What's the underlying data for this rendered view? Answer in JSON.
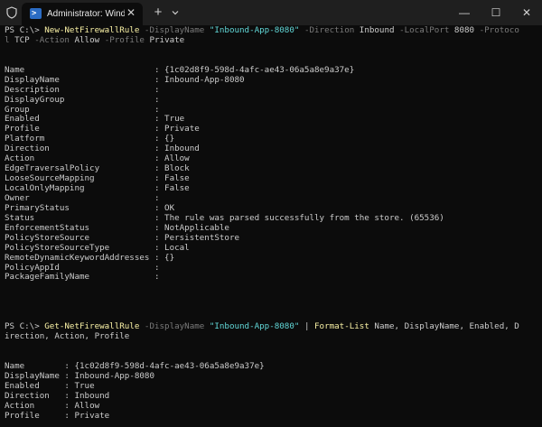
{
  "window": {
    "tab_title": "Administrator: Windows PowerShell",
    "tab_icon_glyph": ">",
    "close_glyph": "✕",
    "new_tab_glyph": "+",
    "minimize_glyph": "—",
    "maximize_glyph": "☐",
    "window_close_glyph": "✕",
    "colors": {
      "titlebar": "#1f1f1f",
      "background": "#0c0c0c",
      "command": "#f9f1a5",
      "parameter": "#7a7a7a",
      "string": "#61d6d6",
      "text": "#cccccc",
      "tab_icon": "#2b6cc4"
    },
    "icons": [
      "shield-icon",
      "powershell-icon",
      "close-icon",
      "plus-icon",
      "chevron-down-icon",
      "minimize-icon",
      "maximize-icon",
      "close-window-icon"
    ]
  },
  "terminal": {
    "cmd1": {
      "line1": [
        {
          "t": "PS C:\\> ",
          "c": "plain"
        },
        {
          "t": "New-NetFirewallRule",
          "c": "cmd"
        },
        {
          "t": " -DisplayName ",
          "c": "param"
        },
        {
          "t": "\"Inbound-App-8080\"",
          "c": "str"
        },
        {
          "t": " -Direction ",
          "c": "param"
        },
        {
          "t": "Inbound",
          "c": "plain"
        },
        {
          "t": " -LocalPort ",
          "c": "param"
        },
        {
          "t": "8080",
          "c": "plain"
        },
        {
          "t": " -Protoco",
          "c": "param"
        }
      ],
      "line2": [
        {
          "t": "l ",
          "c": "param"
        },
        {
          "t": "TCP",
          "c": "plain"
        },
        {
          "t": " -Action ",
          "c": "param"
        },
        {
          "t": "Allow",
          "c": "plain"
        },
        {
          "t": " -Profile ",
          "c": "param"
        },
        {
          "t": "Private",
          "c": "plain"
        }
      ]
    },
    "output1": [
      {
        "name": "Name",
        "value": "{1c02d8f9-598d-4afc-ae43-06a5a8e9a37e}"
      },
      {
        "name": "DisplayName",
        "value": "Inbound-App-8080"
      },
      {
        "name": "Description",
        "value": ""
      },
      {
        "name": "DisplayGroup",
        "value": ""
      },
      {
        "name": "Group",
        "value": ""
      },
      {
        "name": "Enabled",
        "value": "True"
      },
      {
        "name": "Profile",
        "value": "Private"
      },
      {
        "name": "Platform",
        "value": "{}"
      },
      {
        "name": "Direction",
        "value": "Inbound"
      },
      {
        "name": "Action",
        "value": "Allow"
      },
      {
        "name": "EdgeTraversalPolicy",
        "value": "Block"
      },
      {
        "name": "LooseSourceMapping",
        "value": "False"
      },
      {
        "name": "LocalOnlyMapping",
        "value": "False"
      },
      {
        "name": "Owner",
        "value": ""
      },
      {
        "name": "PrimaryStatus",
        "value": "OK"
      },
      {
        "name": "Status",
        "value": "The rule was parsed successfully from the store. (65536)"
      },
      {
        "name": "EnforcementStatus",
        "value": "NotApplicable"
      },
      {
        "name": "PolicyStoreSource",
        "value": "PersistentStore"
      },
      {
        "name": "PolicyStoreSourceType",
        "value": "Local"
      },
      {
        "name": "RemoteDynamicKeywordAddresses",
        "value": "{}"
      },
      {
        "name": "PolicyAppId",
        "value": ""
      },
      {
        "name": "PackageFamilyName",
        "value": ""
      }
    ],
    "cmd2": {
      "line1": [
        {
          "t": "PS C:\\> ",
          "c": "plain"
        },
        {
          "t": "Get-NetFirewallRule",
          "c": "cmd"
        },
        {
          "t": " -DisplayName ",
          "c": "param"
        },
        {
          "t": "\"Inbound-App-8080\"",
          "c": "str"
        },
        {
          "t": " | ",
          "c": "plain"
        },
        {
          "t": "Format-List",
          "c": "cmd"
        },
        {
          "t": " Name, DisplayName, Enabled, D",
          "c": "plain"
        }
      ],
      "line2": [
        {
          "t": "irection, Action, Profile",
          "c": "plain"
        }
      ]
    },
    "output2": [
      {
        "name": "Name",
        "value": "{1c02d8f9-598d-4afc-ae43-06a5a8e9a37e}"
      },
      {
        "name": "DisplayName",
        "value": "Inbound-App-8080"
      },
      {
        "name": "Enabled",
        "value": "True"
      },
      {
        "name": "Direction",
        "value": "Inbound"
      },
      {
        "name": "Action",
        "value": "Allow"
      },
      {
        "name": "Profile",
        "value": "Private"
      }
    ]
  }
}
